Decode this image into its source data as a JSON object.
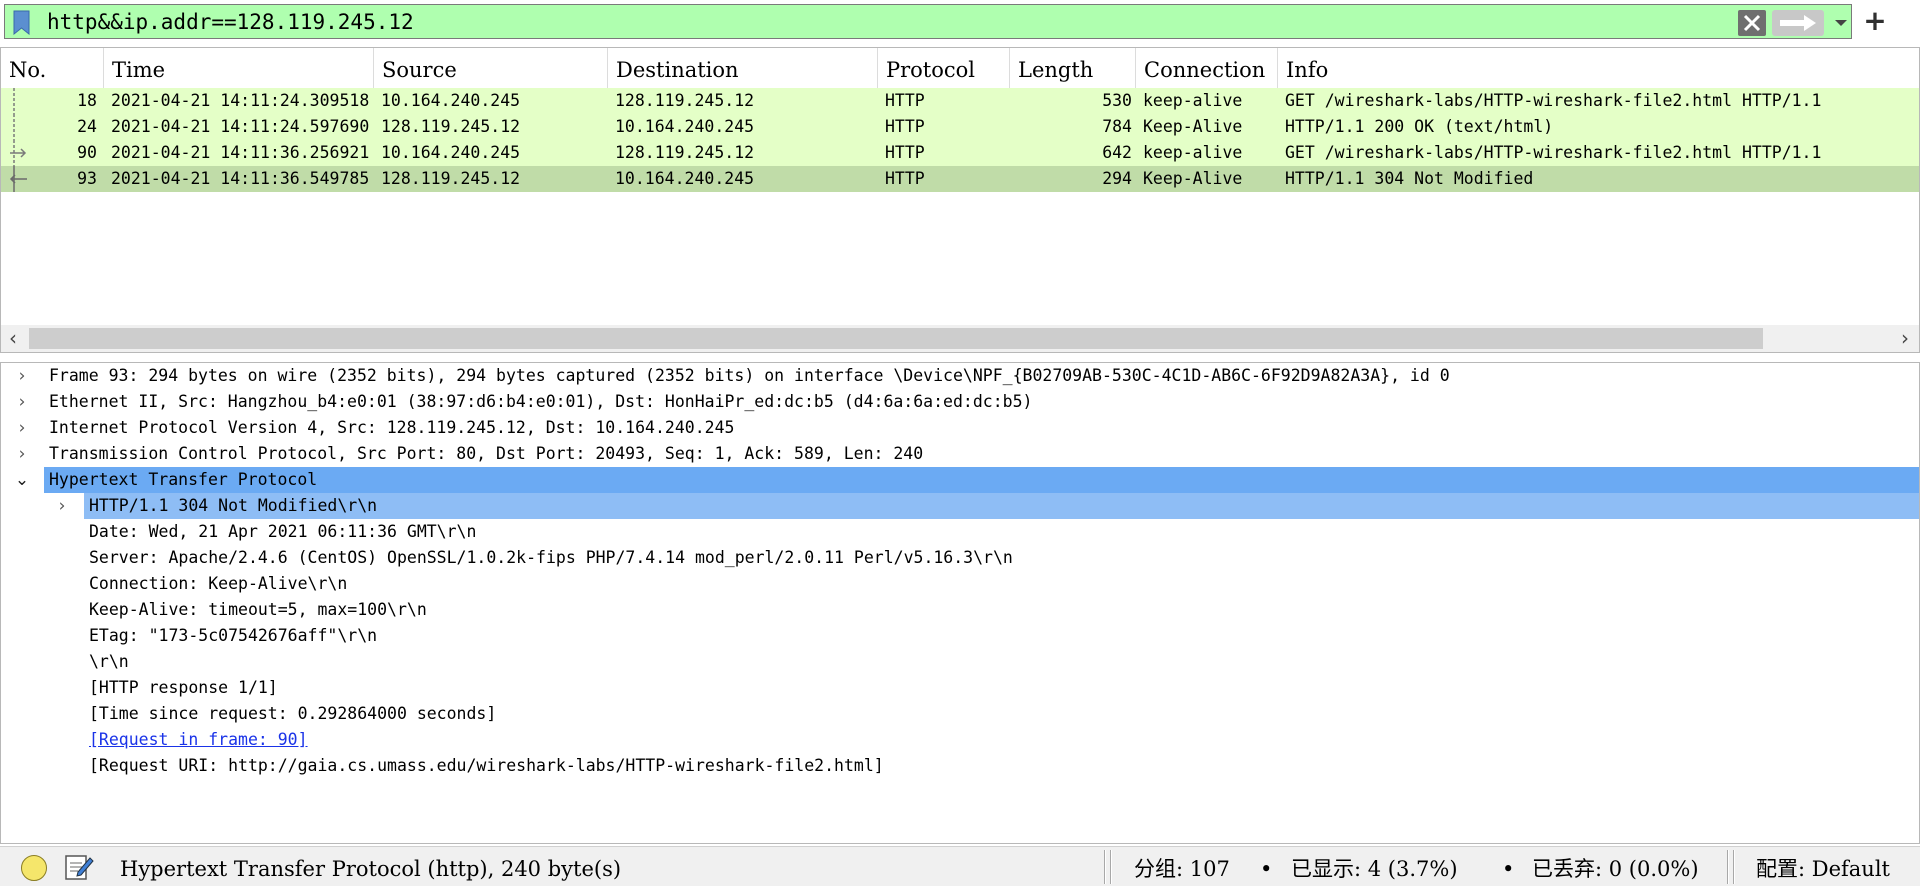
{
  "filter": {
    "value": "http&&ip.addr==128.119.245.12",
    "field_color": "#afffaf"
  },
  "packet_list": {
    "columns": [
      "No.",
      "Time",
      "Source",
      "Destination",
      "Protocol",
      "Length",
      "Connection",
      "Info"
    ],
    "rows": [
      {
        "no": "18",
        "time": "2021-04-21 14:11:24.309518",
        "source": "10.164.240.245",
        "destination": "128.119.245.12",
        "protocol": "HTTP",
        "length": "530",
        "connection": "keep-alive",
        "info": "GET /wireshark-labs/HTTP-wireshark-file2.html HTTP/1.1"
      },
      {
        "no": "24",
        "time": "2021-04-21 14:11:24.597690",
        "source": "128.119.245.12",
        "destination": "10.164.240.245",
        "protocol": "HTTP",
        "length": "784",
        "connection": "Keep-Alive",
        "info": "HTTP/1.1 200 OK  (text/html)"
      },
      {
        "no": "90",
        "time": "2021-04-21 14:11:36.256921",
        "source": "10.164.240.245",
        "destination": "128.119.245.12",
        "protocol": "HTTP",
        "length": "642",
        "connection": "keep-alive",
        "info": "GET /wireshark-labs/HTTP-wireshark-file2.html HTTP/1.1"
      },
      {
        "no": "93",
        "time": "2021-04-21 14:11:36.549785",
        "source": "128.119.245.12",
        "destination": "10.164.240.245",
        "protocol": "HTTP",
        "length": "294",
        "connection": "Keep-Alive",
        "info": "HTTP/1.1 304 Not Modified"
      }
    ],
    "selected_no": "93",
    "row_color": "#e4ffc7",
    "selected_row_color": "#c0dca8"
  },
  "details": {
    "frame": "Frame 93: 294 bytes on wire (2352 bits), 294 bytes captured (2352 bits) on interface \\Device\\NPF_{B02709AB-530C-4C1D-AB6C-6F92D9A82A3A}, id 0",
    "ethernet": "Ethernet II, Src: Hangzhou_b4:e0:01 (38:97:d6:b4:e0:01), Dst: HonHaiPr_ed:dc:b5 (d4:6a:6a:ed:dc:b5)",
    "ip": "Internet Protocol Version 4, Src: 128.119.245.12, Dst: 10.164.240.245",
    "tcp": "Transmission Control Protocol, Src Port: 80, Dst Port: 20493, Seq: 1, Ack: 589, Len: 240",
    "http": "Hypertext Transfer Protocol",
    "http_fields": {
      "status_line": "HTTP/1.1 304 Not Modified\\r\\n",
      "date": "Date: Wed, 21 Apr 2021 06:11:36 GMT\\r\\n",
      "server": "Server: Apache/2.4.6 (CentOS) OpenSSL/1.0.2k-fips PHP/7.4.14 mod_perl/2.0.11 Perl/v5.16.3\\r\\n",
      "connection": "Connection: Keep-Alive\\r\\n",
      "keep_alive": "Keep-Alive: timeout=5, max=100\\r\\n",
      "etag": "ETag: \"173-5c07542676aff\"\\r\\n",
      "crlf": "\\r\\n",
      "response_index": "[HTTP response 1/1]",
      "time_since_request": "[Time since request: 0.292864000 seconds]",
      "request_in_frame": "[Request in frame: 90]",
      "request_uri": "[Request URI: http://gaia.cs.umass.edu/wireshark-labs/HTTP-wireshark-file2.html]"
    },
    "highlight_color": "#6baaf3",
    "sub_highlight_color": "#8ebdf5"
  },
  "status_bar": {
    "field_text": "Hypertext Transfer Protocol (http), 240 byte(s)",
    "packets": "分组: 107",
    "displayed": "已显示: 4 (3.7%)",
    "dropped": "已丢弃: 0 (0.0%)",
    "profile": "配置: Default",
    "separator": "•"
  },
  "icons": [
    "bookmark-icon",
    "clear-icon",
    "apply-arrow-icon",
    "dropdown-chevron-icon",
    "add-icon",
    "expand-chevron-icon",
    "collapse-chevron-icon",
    "status-led-icon",
    "capture-comment-icon"
  ]
}
